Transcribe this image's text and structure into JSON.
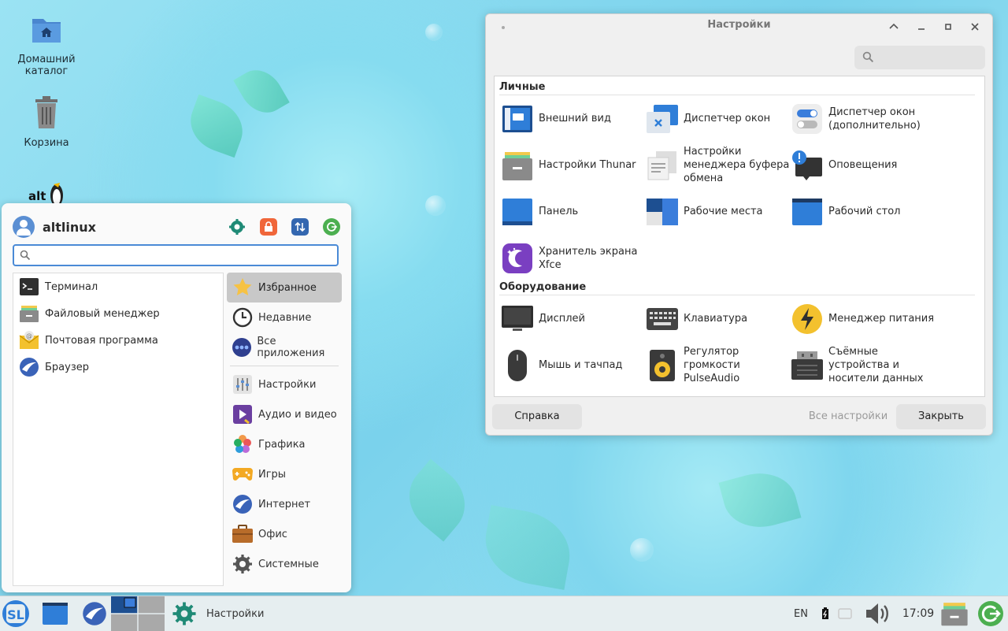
{
  "desktop": {
    "icons": [
      {
        "label": "Домашний каталог",
        "icon": "home-folder-icon"
      },
      {
        "label": "Корзина",
        "icon": "trash-icon"
      }
    ],
    "logo_text": "alt"
  },
  "menu": {
    "username": "altlinux",
    "search_placeholder": "",
    "favorites": [
      {
        "label": "Терминал",
        "icon": "terminal-icon"
      },
      {
        "label": "Файловый менеджер",
        "icon": "file-manager-icon"
      },
      {
        "label": "Почтовая программа",
        "icon": "mail-icon"
      },
      {
        "label": "Браузер",
        "icon": "browser-icon"
      }
    ],
    "categories_top": [
      {
        "label": "Избранное",
        "icon": "star-icon",
        "active": true
      },
      {
        "label": "Недавние",
        "icon": "clock-icon"
      },
      {
        "label": "Все приложения",
        "icon": "apps-icon"
      }
    ],
    "categories": [
      {
        "label": "Настройки",
        "icon": "settings-sliders-icon"
      },
      {
        "label": "Аудио и видео",
        "icon": "multimedia-icon"
      },
      {
        "label": "Графика",
        "icon": "graphics-icon"
      },
      {
        "label": "Игры",
        "icon": "gamepad-icon"
      },
      {
        "label": "Интернет",
        "icon": "internet-icon"
      },
      {
        "label": "Офис",
        "icon": "briefcase-icon"
      },
      {
        "label": "Системные",
        "icon": "gear-icon"
      }
    ]
  },
  "settings": {
    "title": "Настройки",
    "search_placeholder": "",
    "sections": [
      {
        "title": "Личные",
        "items": [
          {
            "label": "Внешний вид",
            "icon": "appearance-icon"
          },
          {
            "label": "Диспетчер окон",
            "icon": "window-manager-icon"
          },
          {
            "label": "Диспетчер окон (дополнительно)",
            "icon": "toggle-switches-icon"
          },
          {
            "label": "Настройки Thunar",
            "icon": "thunar-icon"
          },
          {
            "label": "Настройки менеджера буфера обмена",
            "icon": "clipboard-icon"
          },
          {
            "label": "Оповещения",
            "icon": "notification-icon"
          },
          {
            "label": "Панель",
            "icon": "panel-icon"
          },
          {
            "label": "Рабочие места",
            "icon": "workspaces-icon"
          },
          {
            "label": "Рабочий стол",
            "icon": "desktop-icon"
          },
          {
            "label": "Хранитель экрана Xfce",
            "icon": "screensaver-icon"
          }
        ]
      },
      {
        "title": "Оборудование",
        "items": [
          {
            "label": "Дисплей",
            "icon": "display-icon"
          },
          {
            "label": "Клавиатура",
            "icon": "keyboard-icon"
          },
          {
            "label": "Менеджер питания",
            "icon": "power-icon"
          },
          {
            "label": "Мышь и тачпад",
            "icon": "mouse-icon"
          },
          {
            "label": "Регулятор громкости PulseAudio",
            "icon": "speaker-icon"
          },
          {
            "label": "Съёмные устройства и носители данных",
            "icon": "removable-drive-icon"
          }
        ]
      }
    ],
    "buttons": {
      "help": "Справка",
      "all_settings": "Все настройки",
      "close": "Закрыть"
    }
  },
  "taskbar": {
    "active_window": "Настройки",
    "keyboard_layout": "EN",
    "clock": "17:09"
  }
}
